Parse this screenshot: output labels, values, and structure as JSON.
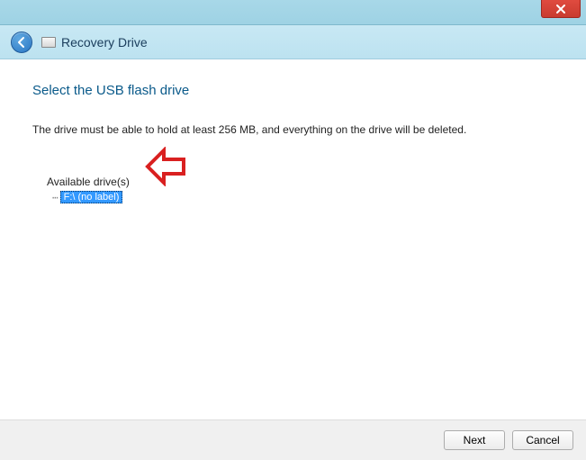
{
  "window": {
    "title": "Recovery Drive"
  },
  "page": {
    "heading": "Select the USB flash drive",
    "instruction": "The drive must be able to hold at least 256 MB, and everything on the drive will be deleted."
  },
  "tree": {
    "label": "Available drive(s)",
    "items": [
      {
        "text": "F:\\ (no label)",
        "selected": true
      }
    ]
  },
  "buttons": {
    "next": "Next",
    "cancel": "Cancel"
  }
}
